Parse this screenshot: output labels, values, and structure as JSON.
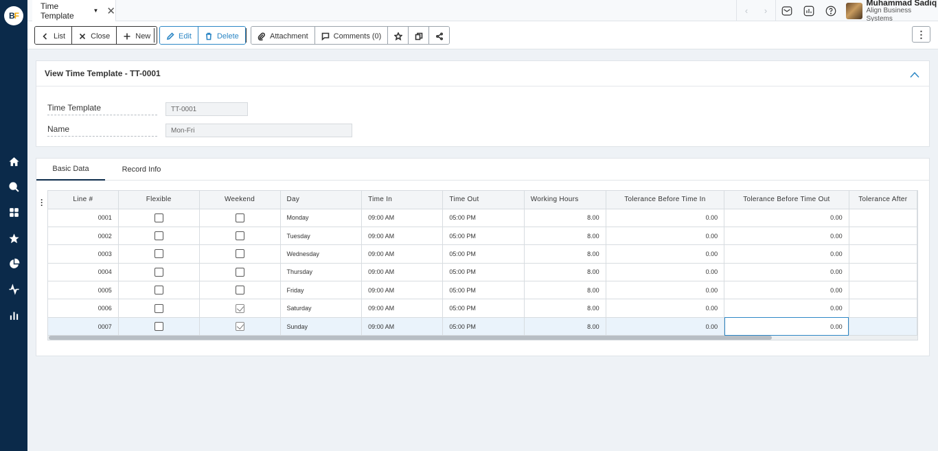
{
  "brand": {
    "logo_b": "B",
    "logo_f": "F"
  },
  "sidebar": {
    "items": [
      {
        "icon": "home-icon"
      },
      {
        "icon": "search-icon"
      },
      {
        "icon": "apps-grid-icon"
      },
      {
        "icon": "star-icon"
      },
      {
        "icon": "pie-chart-icon"
      },
      {
        "icon": "activity-icon"
      },
      {
        "icon": "bar-chart-icon"
      }
    ]
  },
  "topbar": {
    "doc_tab_label": "Time Template",
    "close_glyph": "✕",
    "prev_glyph": "‹",
    "next_glyph": "›",
    "user_name": "Muhammad Sadiq",
    "user_company": "Align Business Systems"
  },
  "toolbar": {
    "list_label": "List",
    "close_label": "Close",
    "new_label": "New",
    "edit_label": "Edit",
    "delete_label": "Delete",
    "attachment_label": "Attachment",
    "comments_label": "Comments (0)",
    "more_glyph": "⋮"
  },
  "header": {
    "title": "View Time Template - TT-0001",
    "fields": {
      "time_template_label": "Time Template",
      "time_template_value": "TT-0001",
      "name_label": "Name",
      "name_value": "Mon-Fri"
    }
  },
  "detail": {
    "tabs": [
      "Basic Data",
      "Record Info"
    ],
    "active_tab": "Basic Data",
    "columns": [
      "Line #",
      "Flexible",
      "Weekend",
      "Day",
      "Time In",
      "Time Out",
      "Working Hours",
      "Tolerance Before Time In",
      "Tolerance Before Time Out",
      "Tolerance After"
    ],
    "rows": [
      {
        "line": "0001",
        "flexible": false,
        "weekend": false,
        "day": "Monday",
        "time_in": "09:00 AM",
        "time_out": "05:00 PM",
        "hours": "8.00",
        "tol_in": "0.00",
        "tol_out": "0.00",
        "tol_after": ""
      },
      {
        "line": "0002",
        "flexible": false,
        "weekend": false,
        "day": "Tuesday",
        "time_in": "09:00 AM",
        "time_out": "05:00 PM",
        "hours": "8.00",
        "tol_in": "0.00",
        "tol_out": "0.00",
        "tol_after": ""
      },
      {
        "line": "0003",
        "flexible": false,
        "weekend": false,
        "day": "Wednesday",
        "time_in": "09:00 AM",
        "time_out": "05:00 PM",
        "hours": "8.00",
        "tol_in": "0.00",
        "tol_out": "0.00",
        "tol_after": ""
      },
      {
        "line": "0004",
        "flexible": false,
        "weekend": false,
        "day": "Thursday",
        "time_in": "09:00 AM",
        "time_out": "05:00 PM",
        "hours": "8.00",
        "tol_in": "0.00",
        "tol_out": "0.00",
        "tol_after": ""
      },
      {
        "line": "0005",
        "flexible": false,
        "weekend": false,
        "day": "Friday",
        "time_in": "09:00 AM",
        "time_out": "05:00 PM",
        "hours": "8.00",
        "tol_in": "0.00",
        "tol_out": "0.00",
        "tol_after": ""
      },
      {
        "line": "0006",
        "flexible": false,
        "weekend": true,
        "day": "Saturday",
        "time_in": "09:00 AM",
        "time_out": "05:00 PM",
        "hours": "8.00",
        "tol_in": "0.00",
        "tol_out": "0.00",
        "tol_after": ""
      },
      {
        "line": "0007",
        "flexible": false,
        "weekend": true,
        "day": "Sunday",
        "time_in": "09:00 AM",
        "time_out": "05:00 PM",
        "hours": "8.00",
        "tol_in": "0.00",
        "tol_out": "0.00",
        "tol_after": ""
      }
    ],
    "selected_row": 6
  },
  "colors": {
    "sidebar": "#0b2a4a",
    "accent": "#2b86c5",
    "logo_accent": "#f0a500",
    "background": "#eef2f6"
  }
}
